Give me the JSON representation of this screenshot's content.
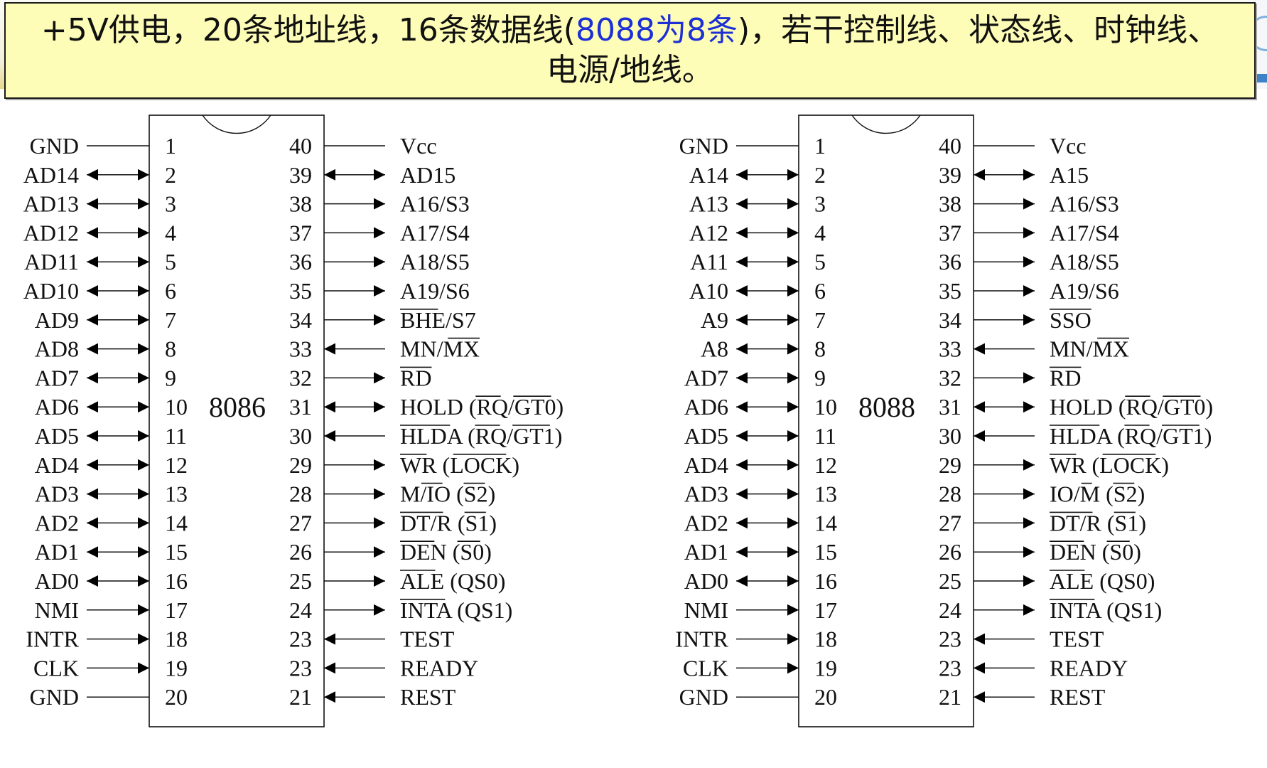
{
  "caption": {
    "part1": "+5V供电，20条地址线，16条数据线(",
    "highlight": "8088为8条",
    "part2": ")，若干控制线、状态线、时钟线、电源/地线。",
    "highlight_color": "#1d2fd6"
  },
  "chips": [
    {
      "name": "8086",
      "left_pins": [
        {
          "num": "1",
          "label": "GND",
          "dir": "none",
          "over": []
        },
        {
          "num": "2",
          "label": "AD14",
          "dir": "bi",
          "over": []
        },
        {
          "num": "3",
          "label": "AD13",
          "dir": "bi",
          "over": []
        },
        {
          "num": "4",
          "label": "AD12",
          "dir": "bi",
          "over": []
        },
        {
          "num": "5",
          "label": "AD11",
          "dir": "bi",
          "over": []
        },
        {
          "num": "6",
          "label": "AD10",
          "dir": "bi",
          "over": []
        },
        {
          "num": "7",
          "label": "AD9",
          "dir": "bi",
          "over": []
        },
        {
          "num": "8",
          "label": "AD8",
          "dir": "bi",
          "over": []
        },
        {
          "num": "9",
          "label": "AD7",
          "dir": "bi",
          "over": []
        },
        {
          "num": "10",
          "label": "AD6",
          "dir": "bi",
          "over": []
        },
        {
          "num": "11",
          "label": "AD5",
          "dir": "bi",
          "over": []
        },
        {
          "num": "12",
          "label": "AD4",
          "dir": "bi",
          "over": []
        },
        {
          "num": "13",
          "label": "AD3",
          "dir": "bi",
          "over": []
        },
        {
          "num": "14",
          "label": "AD2",
          "dir": "bi",
          "over": []
        },
        {
          "num": "15",
          "label": "AD1",
          "dir": "bi",
          "over": []
        },
        {
          "num": "16",
          "label": "AD0",
          "dir": "bi",
          "over": []
        },
        {
          "num": "17",
          "label": "NMI",
          "dir": "in",
          "over": []
        },
        {
          "num": "18",
          "label": "INTR",
          "dir": "in",
          "over": []
        },
        {
          "num": "19",
          "label": "CLK",
          "dir": "in",
          "over": []
        },
        {
          "num": "20",
          "label": "GND",
          "dir": "none",
          "over": []
        }
      ],
      "right_pins": [
        {
          "num": "40",
          "label": "Vcc",
          "dir": "none",
          "over": []
        },
        {
          "num": "39",
          "label": "AD15",
          "dir": "bi",
          "over": []
        },
        {
          "num": "38",
          "label": "A16/S3",
          "dir": "out",
          "over": []
        },
        {
          "num": "37",
          "label": "A17/S4",
          "dir": "out",
          "over": []
        },
        {
          "num": "36",
          "label": "A18/S5",
          "dir": "out",
          "over": []
        },
        {
          "num": "35",
          "label": "A19/S6",
          "dir": "out",
          "over": []
        },
        {
          "num": "34",
          "label": "BHE/S7",
          "dir": "out",
          "over": [
            [
              0,
              3
            ]
          ]
        },
        {
          "num": "33",
          "label": "MN/MX",
          "dir": "in",
          "over": [
            [
              3,
              5
            ]
          ]
        },
        {
          "num": "32",
          "label": "RD",
          "dir": "out",
          "over": [
            [
              0,
              2
            ]
          ]
        },
        {
          "num": "31",
          "label": "HOLD (RQ/GT0)",
          "dir": "bi",
          "over": [
            [
              6,
              8
            ],
            [
              9,
              12
            ]
          ]
        },
        {
          "num": "30",
          "label": "HLDA (RQ/GT1)",
          "dir": "in",
          "over": [
            [
              0,
              4
            ],
            [
              6,
              8
            ],
            [
              9,
              12
            ]
          ]
        },
        {
          "num": "29",
          "label": "WR (LOCK)",
          "dir": "out",
          "over": [
            [
              0,
              2
            ],
            [
              4,
              8
            ]
          ]
        },
        {
          "num": "28",
          "label": "M/IO (S2)",
          "dir": "out",
          "over": [
            [
              2,
              4
            ],
            [
              6,
              8
            ]
          ]
        },
        {
          "num": "27",
          "label": "DT/R (S1)",
          "dir": "out",
          "over": [
            [
              0,
              4
            ],
            [
              6,
              8
            ]
          ]
        },
        {
          "num": "26",
          "label": "DEN (S0)",
          "dir": "out",
          "over": [
            [
              0,
              3
            ],
            [
              5,
              7
            ]
          ]
        },
        {
          "num": "25",
          "label": "ALE (QS0)",
          "dir": "out",
          "over": [
            [
              0,
              3
            ]
          ]
        },
        {
          "num": "24",
          "label": "INTA (QS1)",
          "dir": "out",
          "over": [
            [
              0,
              4
            ]
          ]
        },
        {
          "num": "23",
          "label": "TEST",
          "dir": "in",
          "over": []
        },
        {
          "num": "23",
          "label": "READY",
          "dir": "in",
          "over": []
        },
        {
          "num": "21",
          "label": "REST",
          "dir": "in",
          "over": []
        }
      ]
    },
    {
      "name": "8088",
      "left_pins": [
        {
          "num": "1",
          "label": "GND",
          "dir": "none",
          "over": []
        },
        {
          "num": "2",
          "label": "A14",
          "dir": "bi",
          "over": []
        },
        {
          "num": "3",
          "label": "A13",
          "dir": "bi",
          "over": []
        },
        {
          "num": "4",
          "label": "A12",
          "dir": "bi",
          "over": []
        },
        {
          "num": "5",
          "label": "A11",
          "dir": "bi",
          "over": []
        },
        {
          "num": "6",
          "label": "A10",
          "dir": "bi",
          "over": []
        },
        {
          "num": "7",
          "label": "A9",
          "dir": "bi",
          "over": []
        },
        {
          "num": "8",
          "label": "A8",
          "dir": "bi",
          "over": []
        },
        {
          "num": "9",
          "label": "AD7",
          "dir": "bi",
          "over": []
        },
        {
          "num": "10",
          "label": "AD6",
          "dir": "bi",
          "over": []
        },
        {
          "num": "11",
          "label": "AD5",
          "dir": "bi",
          "over": []
        },
        {
          "num": "12",
          "label": "AD4",
          "dir": "bi",
          "over": []
        },
        {
          "num": "13",
          "label": "AD3",
          "dir": "bi",
          "over": []
        },
        {
          "num": "14",
          "label": "AD2",
          "dir": "bi",
          "over": []
        },
        {
          "num": "15",
          "label": "AD1",
          "dir": "bi",
          "over": []
        },
        {
          "num": "16",
          "label": "AD0",
          "dir": "bi",
          "over": []
        },
        {
          "num": "17",
          "label": "NMI",
          "dir": "in",
          "over": []
        },
        {
          "num": "18",
          "label": "INTR",
          "dir": "in",
          "over": []
        },
        {
          "num": "19",
          "label": "CLK",
          "dir": "in",
          "over": []
        },
        {
          "num": "20",
          "label": "GND",
          "dir": "none",
          "over": []
        }
      ],
      "right_pins": [
        {
          "num": "40",
          "label": "Vcc",
          "dir": "none",
          "over": []
        },
        {
          "num": "39",
          "label": "A15",
          "dir": "bi",
          "over": []
        },
        {
          "num": "38",
          "label": "A16/S3",
          "dir": "out",
          "over": []
        },
        {
          "num": "37",
          "label": "A17/S4",
          "dir": "out",
          "over": []
        },
        {
          "num": "36",
          "label": "A18/S5",
          "dir": "out",
          "over": []
        },
        {
          "num": "35",
          "label": "A19/S6",
          "dir": "out",
          "over": []
        },
        {
          "num": "34",
          "label": "SSO",
          "dir": "out",
          "over": [
            [
              0,
              3
            ]
          ]
        },
        {
          "num": "33",
          "label": "MN/MX",
          "dir": "in",
          "over": [
            [
              3,
              5
            ]
          ]
        },
        {
          "num": "32",
          "label": "RD",
          "dir": "out",
          "over": [
            [
              0,
              2
            ]
          ]
        },
        {
          "num": "31",
          "label": "HOLD (RQ/GT0)",
          "dir": "bi",
          "over": [
            [
              6,
              8
            ],
            [
              9,
              12
            ]
          ]
        },
        {
          "num": "30",
          "label": "HLDA (RQ/GT1)",
          "dir": "in",
          "over": [
            [
              0,
              4
            ],
            [
              6,
              8
            ],
            [
              9,
              12
            ]
          ]
        },
        {
          "num": "29",
          "label": "WR (LOCK)",
          "dir": "out",
          "over": [
            [
              0,
              2
            ],
            [
              4,
              8
            ]
          ]
        },
        {
          "num": "28",
          "label": "IO/M (S2)",
          "dir": "out",
          "over": [
            [
              3,
              4
            ],
            [
              6,
              8
            ]
          ]
        },
        {
          "num": "27",
          "label": "DT/R (S1)",
          "dir": "out",
          "over": [
            [
              0,
              4
            ],
            [
              6,
              8
            ]
          ]
        },
        {
          "num": "26",
          "label": "DEN (S0)",
          "dir": "out",
          "over": [
            [
              0,
              3
            ],
            [
              5,
              7
            ]
          ]
        },
        {
          "num": "25",
          "label": "ALE (QS0)",
          "dir": "out",
          "over": [
            [
              0,
              3
            ]
          ]
        },
        {
          "num": "24",
          "label": "INTA (QS1)",
          "dir": "out",
          "over": [
            [
              0,
              4
            ]
          ]
        },
        {
          "num": "23",
          "label": "TEST",
          "dir": "in",
          "over": []
        },
        {
          "num": "23",
          "label": "READY",
          "dir": "in",
          "over": []
        },
        {
          "num": "21",
          "label": "REST",
          "dir": "in",
          "over": []
        }
      ]
    }
  ]
}
